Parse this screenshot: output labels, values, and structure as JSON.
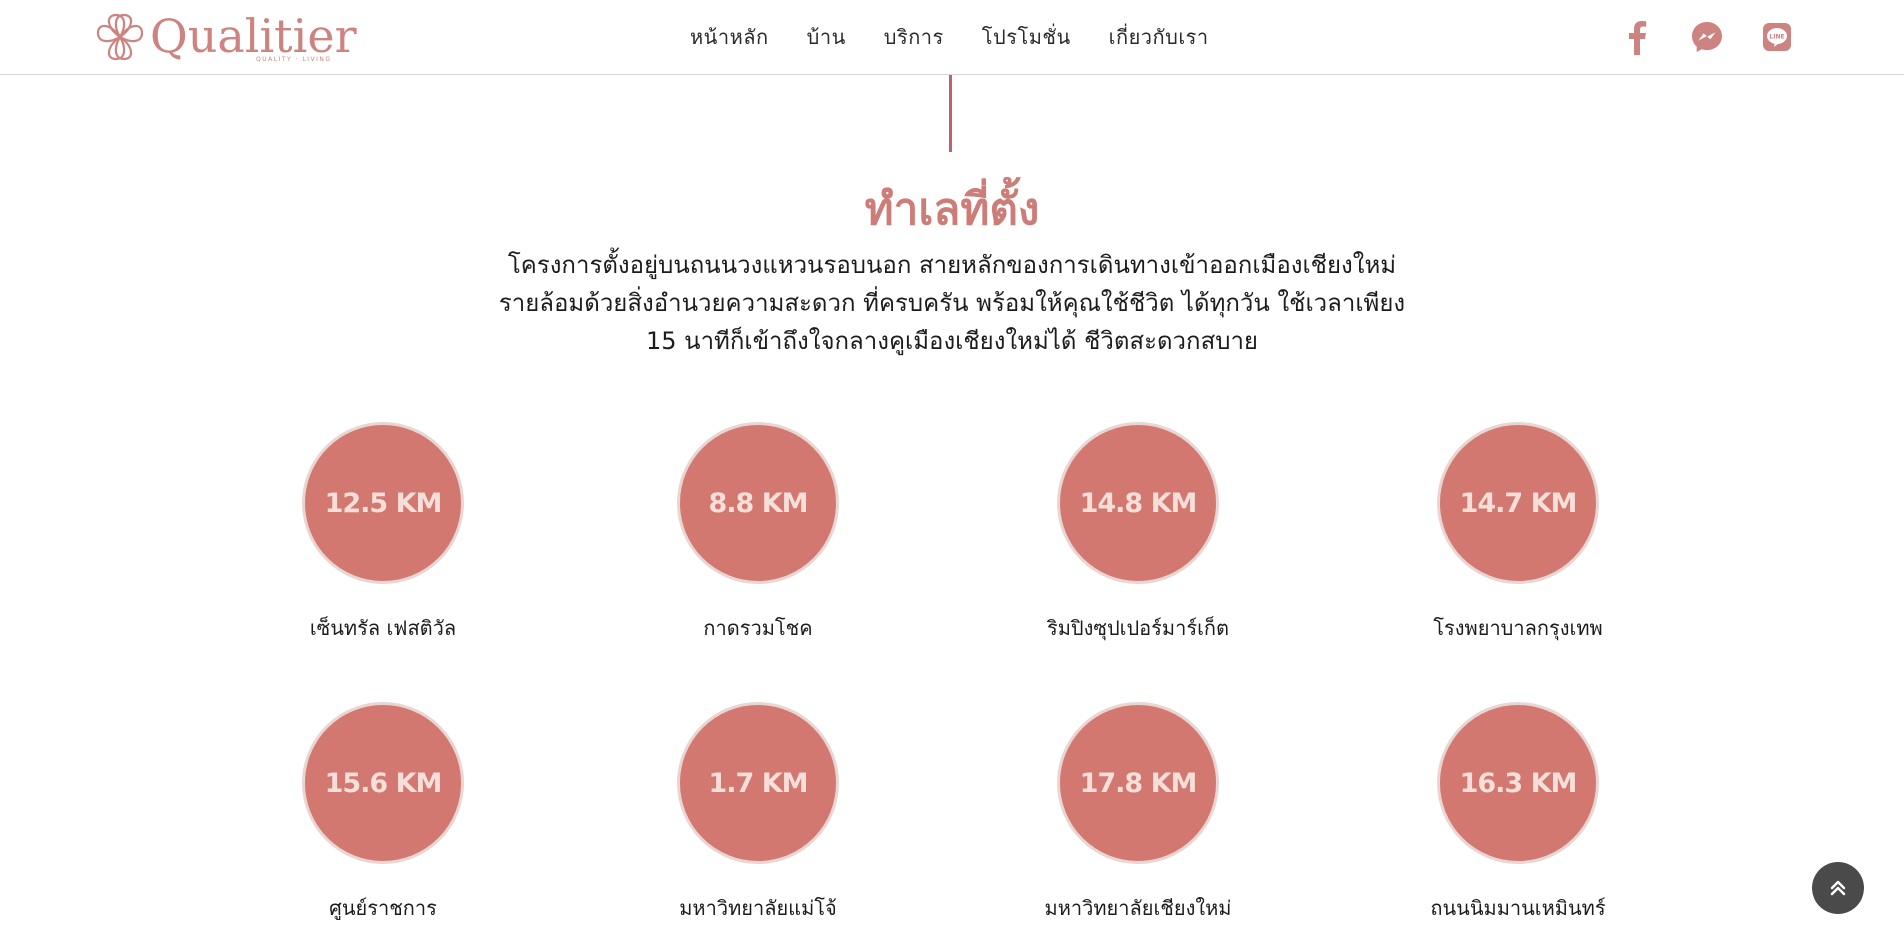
{
  "header": {
    "logo": {
      "wordmark": "Qualitier",
      "tagline": "QUALITY · LIVING"
    },
    "nav": [
      {
        "label": "หน้าหลัก"
      },
      {
        "label": "บ้าน"
      },
      {
        "label": "บริการ"
      },
      {
        "label": "โปรโมชั่น"
      },
      {
        "label": "เกี่ยวกับเรา"
      }
    ],
    "socials": [
      {
        "icon": "facebook-icon"
      },
      {
        "icon": "messenger-icon"
      },
      {
        "icon": "line-icon"
      }
    ]
  },
  "location": {
    "title": "ทำเลที่ตั้ง",
    "description": [
      "โครงการตั้งอยู่บนถนนวงแหวนรอบนอก สายหลักของการเดินทางเข้าออกเมืองเชียงใหม่",
      "รายล้อมด้วยสิ่งอำนวยความสะดวก ที่ครบครัน พร้อมให้คุณใช้ชีวิต ได้ทุกวัน ใช้เวลาเพียง",
      "15 นาทีก็เข้าถึงใจกลางคูเมืองเชียงใหม่ได้ ชีวิตสะดวกสบาย"
    ],
    "places": [
      {
        "distance": "12.5 KM",
        "name": "เซ็นทรัล เฟสติวัล"
      },
      {
        "distance": "8.8 KM",
        "name": "กาดรวมโชค"
      },
      {
        "distance": "14.8 KM",
        "name": "ริมปิงซุปเปอร์มาร์เก็ต"
      },
      {
        "distance": "14.7 KM",
        "name": "โรงพยาบาลกรุงเทพ"
      },
      {
        "distance": "15.6 KM",
        "name": "ศูนย์ราชการ"
      },
      {
        "distance": "1.7 KM",
        "name": "มหาวิทยาลัยแม่โจ้"
      },
      {
        "distance": "17.8 KM",
        "name": "มหาวิทยาลัยเชียงใหม่"
      },
      {
        "distance": "16.3 KM",
        "name": "ถนนนิมมานเหมินทร์"
      }
    ]
  },
  "scroll_top": {
    "icon": "double-chevron-up-icon"
  },
  "colors": {
    "accent": "#cd8480",
    "circle_fill": "#d27871",
    "circle_text": "#f6dfd9",
    "divider": "#b9646a",
    "scroll_button": "#4a4a4a"
  }
}
